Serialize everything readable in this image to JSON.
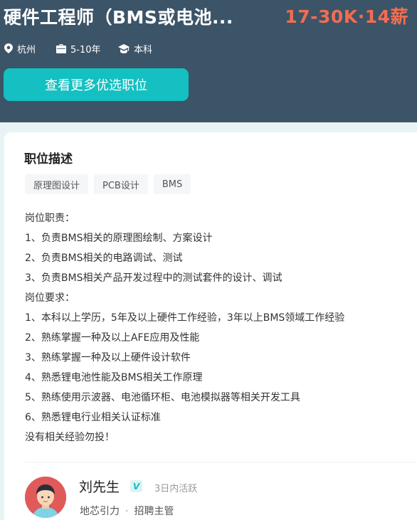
{
  "header": {
    "title": "硬件工程师（BMS或电池...",
    "salary": "17-30K·14薪",
    "city": "杭州",
    "experience": "5-10年",
    "education": "本科",
    "cta_label": "查看更多优选职位"
  },
  "job": {
    "section_title": "职位描述",
    "tags": [
      "原理图设计",
      "PCB设计",
      "BMS"
    ],
    "description": [
      "岗位职责：",
      "1、负责BMS相关的原理图绘制、方案设计",
      "2、负责BMS相关的电路调试、测试",
      "3、负责BMS相关产品开发过程中的测试套件的设计、调试",
      "岗位要求：",
      "1、本科以上学历，5年及以上硬件工作经验，3年以上BMS领域工作经验",
      "2、熟练掌握一种及以上AFE应用及性能",
      "3、熟练掌握一种及以上硬件设计软件",
      "4、熟悉锂电池性能及BMS相关工作原理",
      "5、熟练使用示波器、电池循环柜、电池模拟器等相关开发工具",
      "6、熟悉锂电行业相关认证标准",
      "没有相关经验勿投！"
    ]
  },
  "recruiter": {
    "name": "刘先生",
    "verified_mark": "V",
    "active_status": "3日内活跃",
    "company": "地芯引力",
    "separator": "·",
    "role": "招聘主管"
  },
  "colors": {
    "header_bg": "#3c5468",
    "salary": "#f26d50",
    "accent": "#14c0c1"
  },
  "icons": {
    "city": "location-pin-icon",
    "experience": "briefcase-icon",
    "education": "graduation-cap-icon"
  }
}
